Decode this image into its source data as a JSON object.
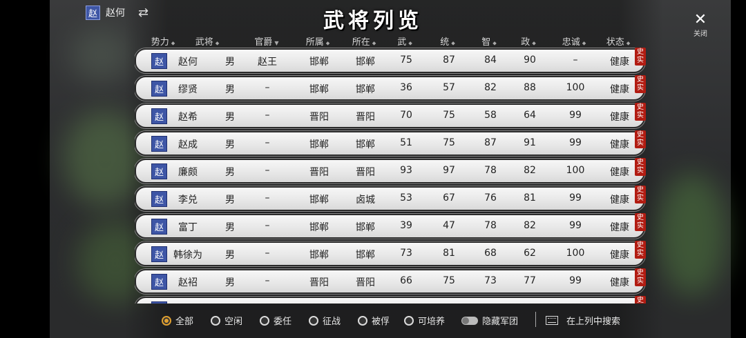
{
  "header": {
    "player_faction": "赵",
    "player_name": "赵何",
    "swap_icon": "⇄",
    "title": "武将列览",
    "close_icon": "✕",
    "close_label": "关闭"
  },
  "columns": [
    {
      "label": "势力",
      "sortable": true
    },
    {
      "label": "武将",
      "sortable": true
    },
    {
      "label": "官爵",
      "sortable": true,
      "active": true
    },
    {
      "label": "所属",
      "sortable": true
    },
    {
      "label": "所在",
      "sortable": true
    },
    {
      "label": "武",
      "sortable": true
    },
    {
      "label": "统",
      "sortable": true
    },
    {
      "label": "智",
      "sortable": true
    },
    {
      "label": "政",
      "sortable": true
    },
    {
      "label": "忠诚",
      "sortable": true
    },
    {
      "label": "状态",
      "sortable": true
    }
  ],
  "sort_icon": "⬥",
  "sort_active_icon": "▼",
  "rows": [
    {
      "faction": "赵",
      "name": "赵何",
      "gender": "男",
      "rank": "赵王",
      "belong": "邯郸",
      "location": "邯郸",
      "wu": "75",
      "tong": "87",
      "zhi": "84",
      "zheng": "90",
      "loyalty": "–",
      "status": "健康",
      "tag": "史实"
    },
    {
      "faction": "赵",
      "name": "缪贤",
      "gender": "男",
      "rank": "–",
      "belong": "邯郸",
      "location": "邯郸",
      "wu": "36",
      "tong": "57",
      "zhi": "82",
      "zheng": "88",
      "loyalty": "100",
      "status": "健康",
      "tag": "史实"
    },
    {
      "faction": "赵",
      "name": "赵希",
      "gender": "男",
      "rank": "–",
      "belong": "晋阳",
      "location": "晋阳",
      "wu": "70",
      "tong": "75",
      "zhi": "58",
      "zheng": "64",
      "loyalty": "99",
      "status": "健康",
      "tag": "史实"
    },
    {
      "faction": "赵",
      "name": "赵成",
      "gender": "男",
      "rank": "–",
      "belong": "邯郸",
      "location": "邯郸",
      "wu": "51",
      "tong": "75",
      "zhi": "87",
      "zheng": "91",
      "loyalty": "99",
      "status": "健康",
      "tag": "史实"
    },
    {
      "faction": "赵",
      "name": "廉颇",
      "gender": "男",
      "rank": "–",
      "belong": "晋阳",
      "location": "晋阳",
      "wu": "93",
      "tong": "97",
      "zhi": "78",
      "zheng": "82",
      "loyalty": "100",
      "status": "健康",
      "tag": "史实"
    },
    {
      "faction": "赵",
      "name": "李兑",
      "gender": "男",
      "rank": "–",
      "belong": "邯郸",
      "location": "卤城",
      "wu": "53",
      "tong": "67",
      "zhi": "76",
      "zheng": "81",
      "loyalty": "99",
      "status": "健康",
      "tag": "史实"
    },
    {
      "faction": "赵",
      "name": "富丁",
      "gender": "男",
      "rank": "–",
      "belong": "邯郸",
      "location": "邯郸",
      "wu": "39",
      "tong": "47",
      "zhi": "78",
      "zheng": "82",
      "loyalty": "99",
      "status": "健康",
      "tag": "史实"
    },
    {
      "faction": "赵",
      "name": "韩徐为",
      "gender": "男",
      "rank": "–",
      "belong": "邯郸",
      "location": "邯郸",
      "wu": "73",
      "tong": "81",
      "zhi": "68",
      "zheng": "62",
      "loyalty": "100",
      "status": "健康",
      "tag": "史实"
    },
    {
      "faction": "赵",
      "name": "赵袑",
      "gender": "男",
      "rank": "–",
      "belong": "晋阳",
      "location": "晋阳",
      "wu": "66",
      "tong": "75",
      "zhi": "73",
      "zheng": "77",
      "loyalty": "99",
      "status": "健康",
      "tag": "史实"
    }
  ],
  "partial_row": {
    "faction": "赵",
    "tag": "史实"
  },
  "footer": {
    "filters": [
      {
        "label": "全部",
        "selected": true
      },
      {
        "label": "空闲",
        "selected": false
      },
      {
        "label": "委任",
        "selected": false
      },
      {
        "label": "征战",
        "selected": false
      },
      {
        "label": "被俘",
        "selected": false
      },
      {
        "label": "可培养",
        "selected": false
      }
    ],
    "toggle_label": "隐藏军团",
    "search_label": "在上列中搜索"
  },
  "colors": {
    "faction_blue": "#3e56a6",
    "tag_red": "#b21c12",
    "radio_active": "#e0a030"
  }
}
